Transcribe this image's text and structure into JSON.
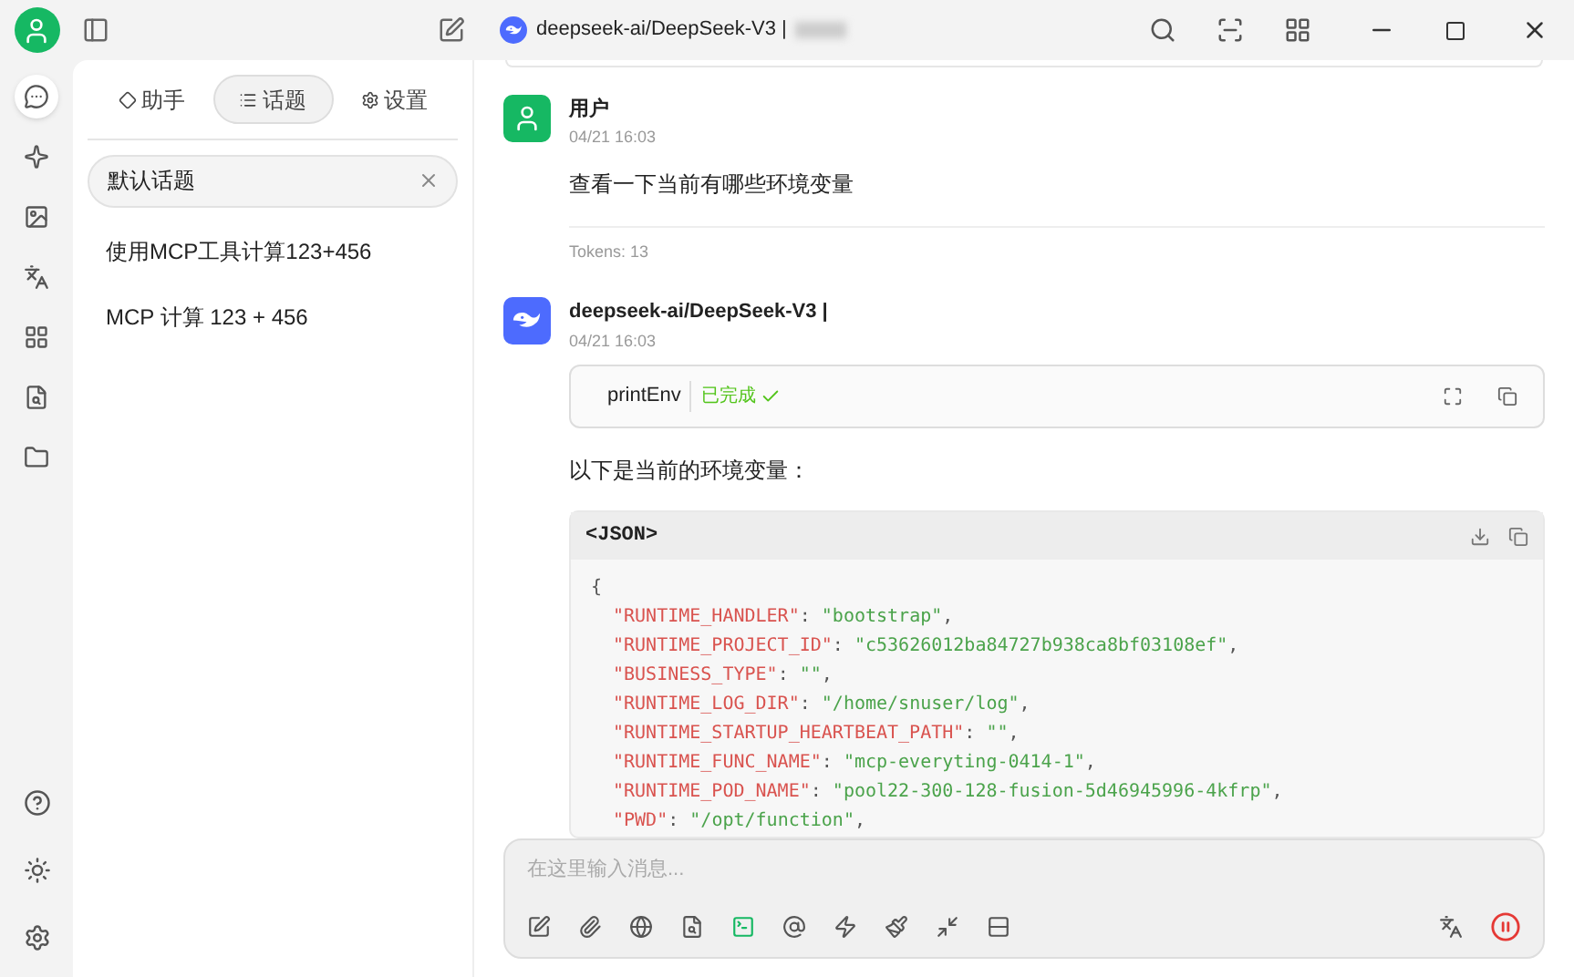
{
  "titlebar": {
    "model": "deepseek-ai/DeepSeek-V3 |"
  },
  "rail": [
    {
      "selected": true
    },
    {
      "selected": false
    },
    {
      "selected": false
    },
    {
      "selected": false
    },
    {
      "selected": false
    },
    {
      "selected": false
    },
    {
      "selected": false
    }
  ],
  "sidebar": {
    "tabs": [
      {
        "label": "助手",
        "selected": false
      },
      {
        "label": "话题",
        "selected": true
      },
      {
        "label": "设置",
        "selected": false
      }
    ],
    "search": {
      "value": "默认话题"
    },
    "items": [
      {
        "label": "使用MCP工具计算123+456"
      },
      {
        "label": "MCP 计算 123 + 456"
      }
    ]
  },
  "messages": [
    {
      "kind": "user",
      "name": "用户",
      "time": "04/21 16:03",
      "text": "查看一下当前有哪些环境变量",
      "tokens": "Tokens: 13"
    },
    {
      "kind": "assistant",
      "name": "deepseek-ai/DeepSeek-V3 |",
      "time": "04/21 16:03",
      "tool": {
        "name": "printEnv",
        "status": "已完成"
      },
      "text": "以下是当前的环境变量：",
      "code": {
        "language": "<JSON>",
        "lines": [
          [
            {
              "kind": "punct",
              "text": "{"
            }
          ],
          [
            {
              "kind": "key",
              "text": "\"RUNTIME_HANDLER\""
            },
            {
              "kind": "punct",
              "text": ": "
            },
            {
              "kind": "string",
              "text": "\"bootstrap\""
            },
            {
              "kind": "punct",
              "text": ","
            }
          ],
          [
            {
              "kind": "key",
              "text": "\"RUNTIME_PROJECT_ID\""
            },
            {
              "kind": "punct",
              "text": ": "
            },
            {
              "kind": "string",
              "text": "\"c53626012ba84727b938ca8bf03108ef\""
            },
            {
              "kind": "punct",
              "text": ","
            }
          ],
          [
            {
              "kind": "key",
              "text": "\"BUSINESS_TYPE\""
            },
            {
              "kind": "punct",
              "text": ": "
            },
            {
              "kind": "string",
              "text": "\"\""
            },
            {
              "kind": "punct",
              "text": ","
            }
          ],
          [
            {
              "kind": "key",
              "text": "\"RUNTIME_LOG_DIR\""
            },
            {
              "kind": "punct",
              "text": ": "
            },
            {
              "kind": "string",
              "text": "\"/home/snuser/log\""
            },
            {
              "kind": "punct",
              "text": ","
            }
          ],
          [
            {
              "kind": "key",
              "text": "\"RUNTIME_STARTUP_HEARTBEAT_PATH\""
            },
            {
              "kind": "punct",
              "text": ": "
            },
            {
              "kind": "string",
              "text": "\"\""
            },
            {
              "kind": "punct",
              "text": ","
            }
          ],
          [
            {
              "kind": "key",
              "text": "\"RUNTIME_FUNC_NAME\""
            },
            {
              "kind": "punct",
              "text": ": "
            },
            {
              "kind": "string",
              "text": "\"mcp-everyting-0414-1\""
            },
            {
              "kind": "punct",
              "text": ","
            }
          ],
          [
            {
              "kind": "key",
              "text": "\"RUNTIME_POD_NAME\""
            },
            {
              "kind": "punct",
              "text": ": "
            },
            {
              "kind": "string",
              "text": "\"pool22-300-128-fusion-5d46945996-4kfrp\""
            },
            {
              "kind": "punct",
              "text": ","
            }
          ],
          [
            {
              "kind": "key",
              "text": "\"PWD\""
            },
            {
              "kind": "punct",
              "text": ": "
            },
            {
              "kind": "string",
              "text": "\"/opt/function\""
            },
            {
              "kind": "punct",
              "text": ","
            }
          ]
        ]
      }
    }
  ],
  "composer": {
    "placeholder": "在这里输入消息..."
  }
}
